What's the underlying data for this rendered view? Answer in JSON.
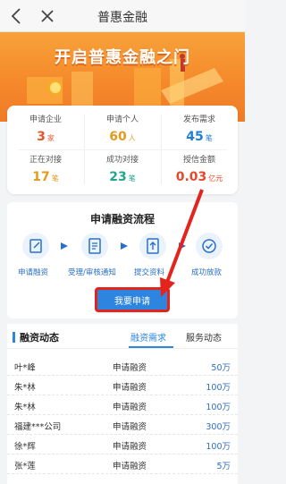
{
  "nav": {
    "title": "普惠金融"
  },
  "banner": {
    "title": "开启普惠金融之门"
  },
  "stats": [
    {
      "label": "申请企业",
      "value": "3",
      "unit": "家",
      "color": "#e8542a"
    },
    {
      "label": "申请个人",
      "value": "60",
      "unit": "人",
      "color": "#e39b1b"
    },
    {
      "label": "发布需求",
      "value": "45",
      "unit": "笔",
      "color": "#1f7fd6"
    },
    {
      "label": "正在对接",
      "value": "17",
      "unit": "笔",
      "color": "#e39b1b"
    },
    {
      "label": "成功对接",
      "value": "23",
      "unit": "笔",
      "color": "#21a68a"
    },
    {
      "label": "授信金额",
      "value": "0.03",
      "unit": "亿元",
      "color": "#e8482a"
    }
  ],
  "flow": {
    "title": "申请融资流程",
    "steps": [
      {
        "label": "申请融资",
        "icon": "edit-icon"
      },
      {
        "label": "受理/审核通知",
        "icon": "document-icon"
      },
      {
        "label": "提交资料",
        "icon": "upload-icon"
      },
      {
        "label": "成功放款",
        "icon": "check-icon"
      }
    ],
    "apply_button": "我要申请"
  },
  "news": {
    "title": "融资动态",
    "tabs": [
      "融资需求",
      "服务动态"
    ],
    "active_tab": 0,
    "rows": [
      {
        "name": "叶*峰",
        "type": "申请融资",
        "amount": "50万"
      },
      {
        "name": "朱*林",
        "type": "申请融资",
        "amount": "100万"
      },
      {
        "name": "朱*林",
        "type": "申请融资",
        "amount": "100万"
      },
      {
        "name": "福建***公司",
        "type": "申请融资",
        "amount": "300万"
      },
      {
        "name": "徐*辉",
        "type": "申请融资",
        "amount": "100万"
      },
      {
        "name": "张*莲",
        "type": "申请融资",
        "amount": "5万"
      }
    ]
  }
}
